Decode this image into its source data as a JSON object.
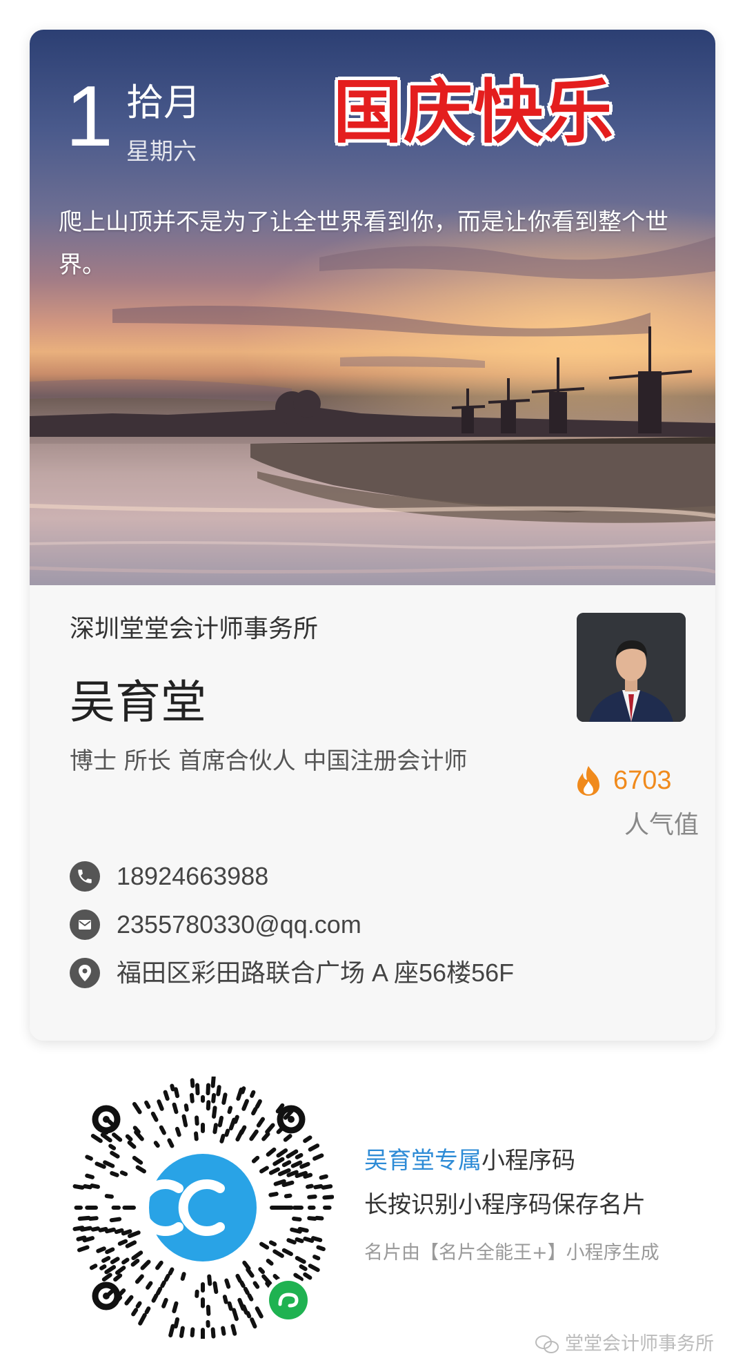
{
  "hero": {
    "day": "1",
    "month": "拾月",
    "weekday": "星期六",
    "badge": "国庆快乐",
    "quote": "爬上山顶并不是为了让全世界看到你，而是让你看到整个世界。"
  },
  "card": {
    "company": "深圳堂堂会计师事务所",
    "name": "吴育堂",
    "titles": "博士 所长 首席合伙人 中国注册会计师",
    "popularity": {
      "count": "6703",
      "label": "人气值",
      "icon": "flame-icon"
    },
    "contacts": {
      "phone": {
        "icon": "phone-icon",
        "value": "18924663988"
      },
      "email": {
        "icon": "mail-icon",
        "value": "2355780330@qq.com"
      },
      "address": {
        "icon": "location-pin-icon",
        "value": "福田区彩田路联合广场 A 座56楼56F"
      }
    }
  },
  "miniprogram": {
    "owner": "吴育堂专属",
    "code_label": "小程序码",
    "instruction": "长按识别小程序码保存名片",
    "generated_by": "名片由【名片全能王+】小程序生成"
  },
  "watermark": "堂堂会计师事务所",
  "colors": {
    "badge_red": "#e41e1e",
    "link_blue": "#2d8bd6",
    "flame_orange": "#f08a1c",
    "logo_blue": "#29a3e6",
    "mini_green": "#1fb251"
  }
}
